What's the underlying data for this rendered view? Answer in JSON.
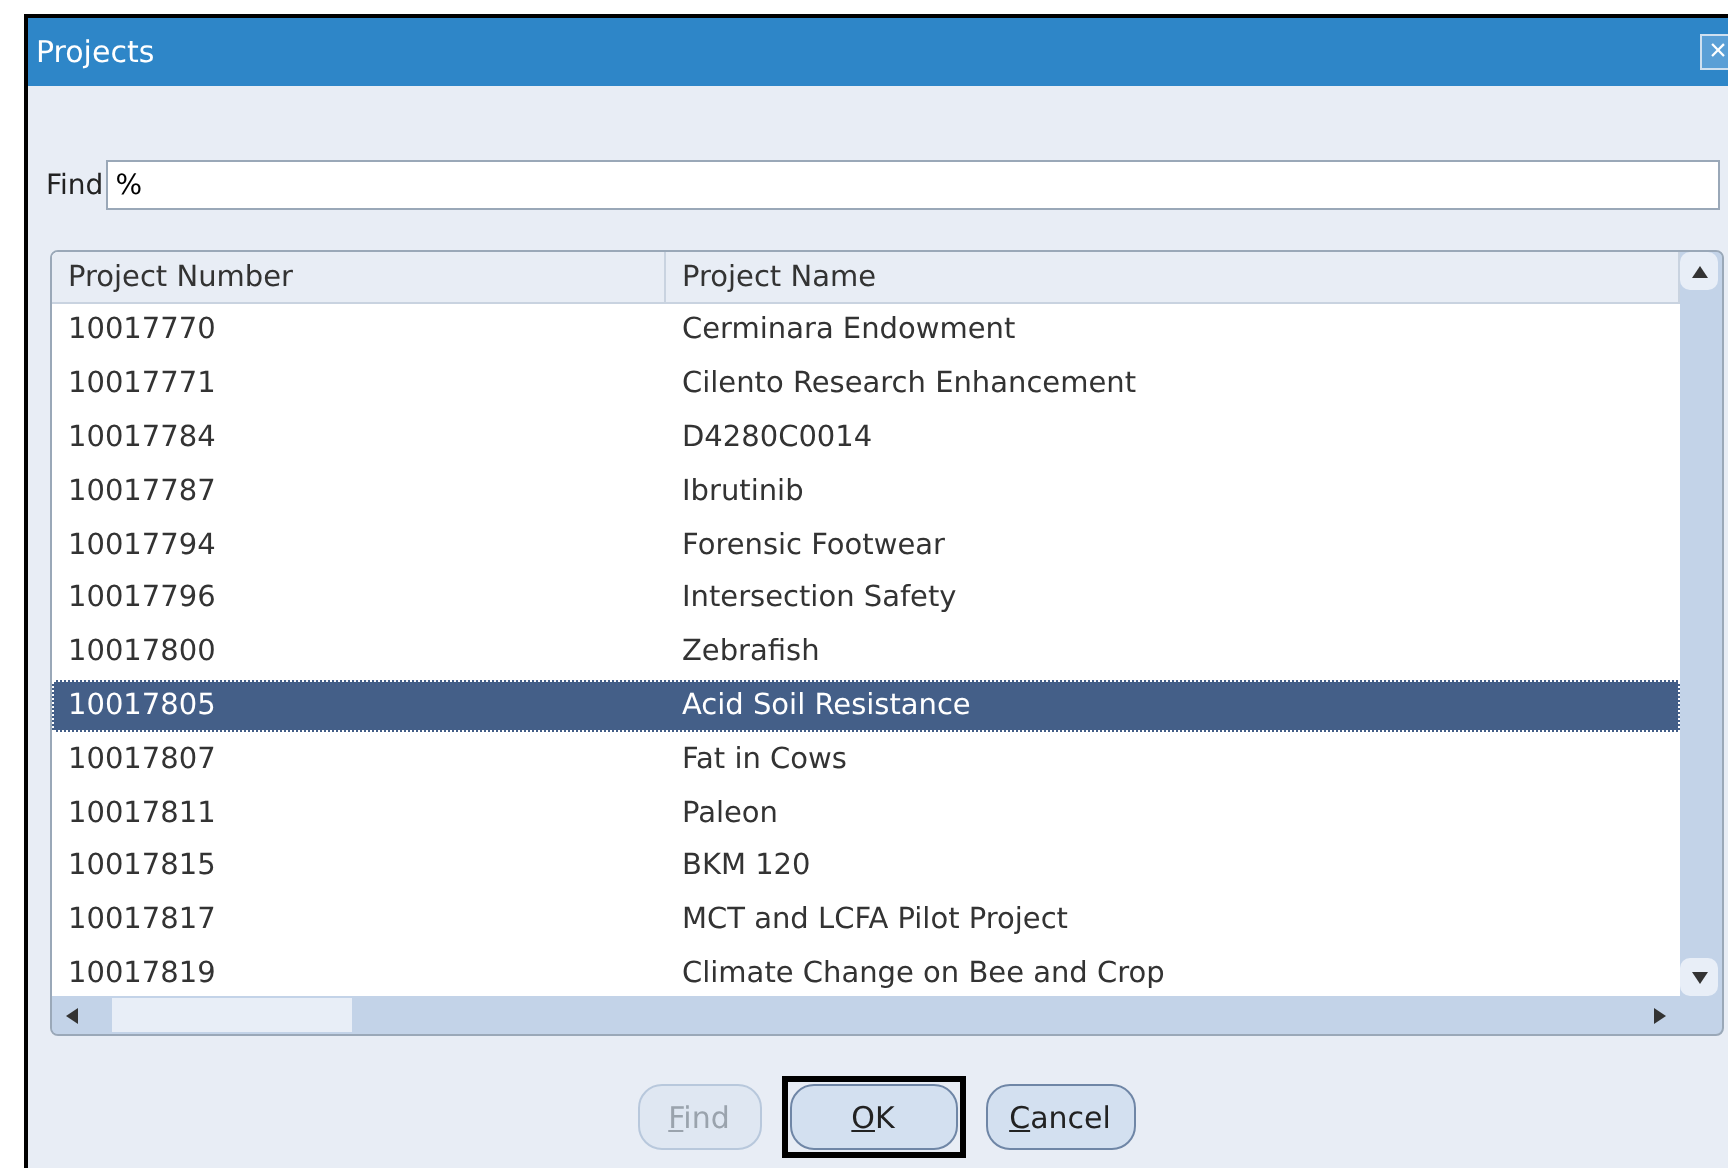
{
  "window": {
    "title": "Projects",
    "close": "×"
  },
  "find": {
    "label": "Find",
    "value": "%"
  },
  "table": {
    "columns": [
      "Project Number",
      "Project Name"
    ],
    "rows": [
      {
        "number": "10017770",
        "name": "Cerminara Endowment",
        "selected": false
      },
      {
        "number": "10017771",
        "name": "Cilento Research Enhancement",
        "selected": false
      },
      {
        "number": "10017784",
        "name": "D4280C0014",
        "selected": false
      },
      {
        "number": "10017787",
        "name": "Ibrutinib",
        "selected": false
      },
      {
        "number": "10017794",
        "name": "Forensic Footwear",
        "selected": false
      },
      {
        "number": "10017796",
        "name": "Intersection Safety",
        "selected": false
      },
      {
        "number": "10017800",
        "name": "Zebrafish",
        "selected": false
      },
      {
        "number": "10017805",
        "name": "Acid Soil Resistance",
        "selected": true
      },
      {
        "number": "10017807",
        "name": "Fat in Cows",
        "selected": false
      },
      {
        "number": "10017811",
        "name": "Paleon",
        "selected": false
      },
      {
        "number": "10017815",
        "name": "BKM 120",
        "selected": false
      },
      {
        "number": "10017817",
        "name": "MCT and LCFA Pilot Project",
        "selected": false
      },
      {
        "number": "10017819",
        "name": "Climate Change on Bee and Crop",
        "selected": false
      }
    ]
  },
  "buttons": [
    {
      "label": "Find",
      "disabled": true,
      "focused": false
    },
    {
      "label": "OK",
      "disabled": false,
      "focused": true
    },
    {
      "label": "Cancel",
      "disabled": false,
      "focused": false
    }
  ]
}
